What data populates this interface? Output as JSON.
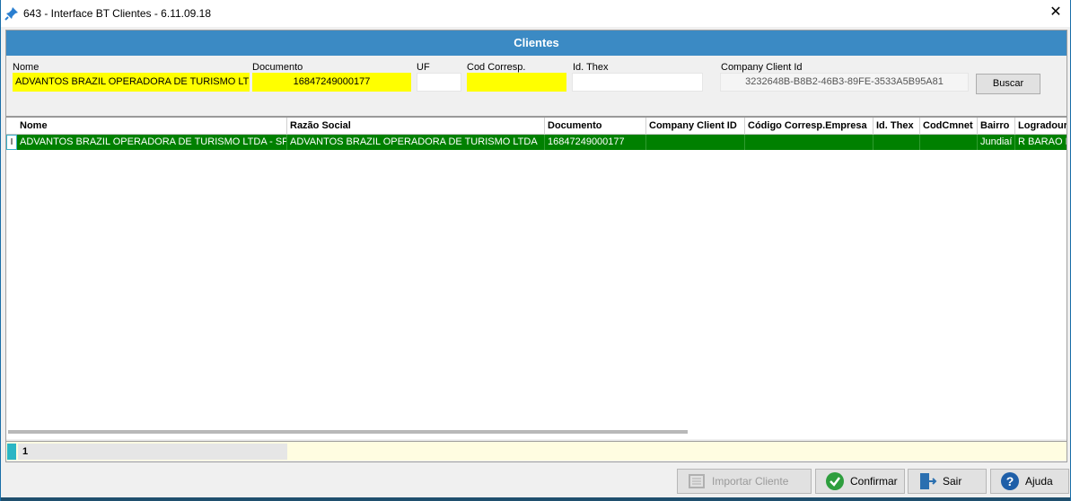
{
  "window": {
    "title": "643 - Interface BT Clientes - 6.11.09.18",
    "close_glyph": "✕"
  },
  "header": {
    "title": "Clientes"
  },
  "filters": {
    "nome_label": "Nome",
    "nome_value": "ADVANTOS BRAZIL OPERADORA DE TURISMO LTDA",
    "documento_label": "Documento",
    "documento_value": "16847249000177",
    "uf_label": "UF",
    "uf_value": "",
    "cod_corresp_label": "Cod Corresp.",
    "cod_corresp_value": "",
    "id_thex_label": "Id. Thex",
    "id_thex_value": "",
    "company_client_id_label": "Company Client Id",
    "company_client_id_value": "3232648B-B8B2-46B3-89FE-3533A5B95A81",
    "buscar_label": "Buscar"
  },
  "grid": {
    "columns": [
      "Nome",
      "Razão Social",
      "Documento",
      "Company Client ID",
      "Código Corresp.Empresa",
      "Id. Thex",
      "CodCmnet",
      "Bairro",
      "Logradouro"
    ],
    "rows": [
      [
        "ADVANTOS BRAZIL OPERADORA DE TURISMO LTDA - SP",
        "ADVANTOS BRAZIL OPERADORA DE TURISMO LTDA",
        "16847249000177",
        "",
        "",
        "",
        "",
        "Jundiaí",
        "R BARAO D"
      ]
    ],
    "row_indicator": "I"
  },
  "footer": {
    "record_count": "1"
  },
  "actions": {
    "importar": "Importar Cliente",
    "confirmar": "Confirmar",
    "sair": "Sair",
    "ajuda": "Ajuda"
  },
  "colors": {
    "header": "#3b8ac4",
    "selected_row": "#008000",
    "highlight": "#ffff00"
  }
}
